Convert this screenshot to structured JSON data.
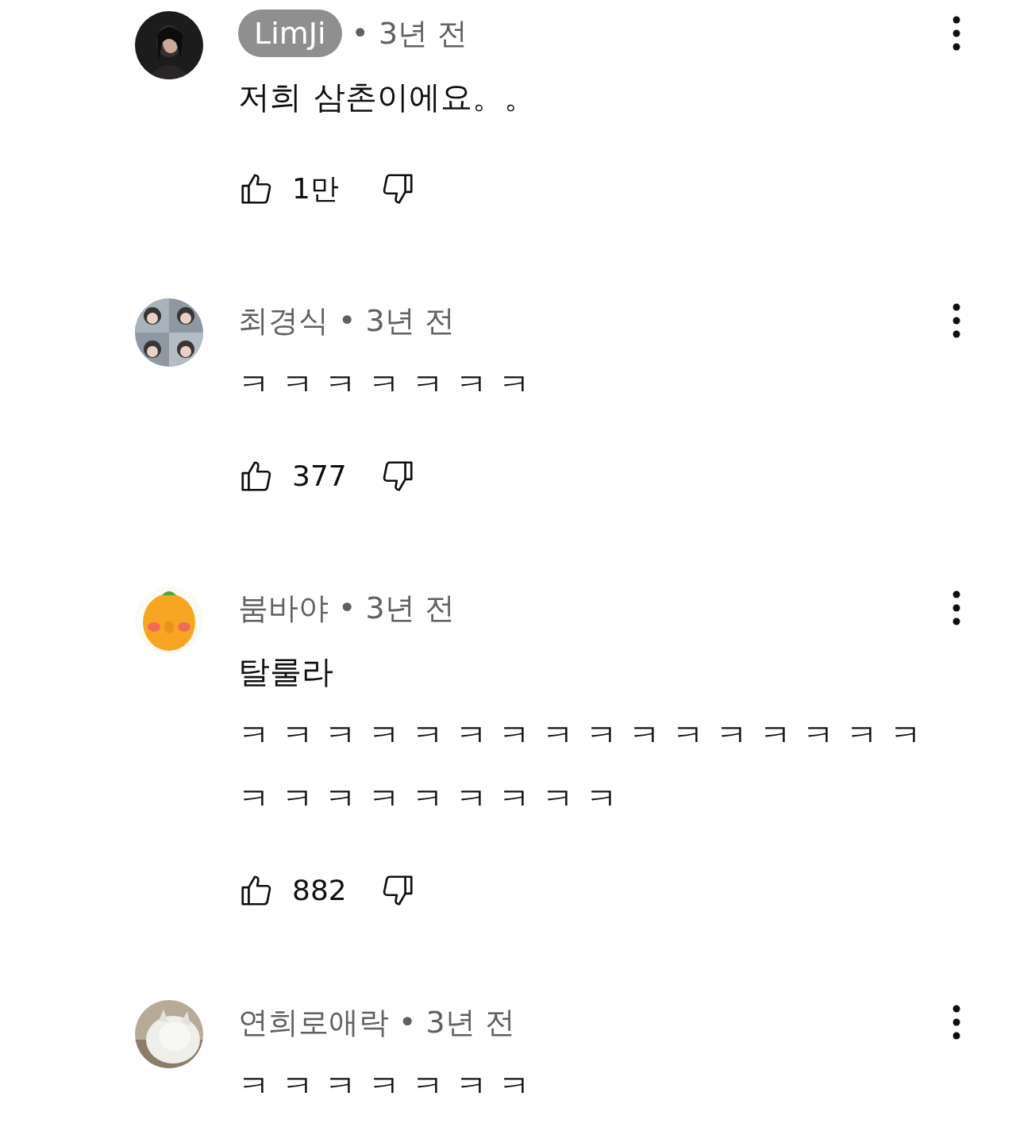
{
  "comments": [
    {
      "author": "LimJi",
      "highlighted": true,
      "time": "• 3년 전",
      "lines": [
        "저희 삼촌이에요。。"
      ],
      "likes": "1만"
    },
    {
      "author": "최경식",
      "highlighted": false,
      "time": "• 3년 전",
      "lines": [
        "ㅋ ㅋ ㅋ ㅋ ㅋ ㅋ ㅋ"
      ],
      "likes": "377"
    },
    {
      "author": "붐바야",
      "highlighted": false,
      "time": "• 3년 전",
      "lines": [
        "탈룰라",
        "ㅋ ㅋ ㅋ ㅋ ㅋ ㅋ ㅋ ㅋ ㅋ ㅋ ㅋ ㅋ ㅋ ㅋ ㅋ ㅋ",
        "ㅋ ㅋ ㅋ ㅋ ㅋ ㅋ ㅋ ㅋ ㅋ"
      ],
      "likes": "882"
    },
    {
      "author": "연희로애락",
      "highlighted": false,
      "time": "• 3년 전",
      "lines": [
        "ㅋ ㅋ ㅋ ㅋ ㅋ ㅋ ㅋ"
      ]
    }
  ]
}
